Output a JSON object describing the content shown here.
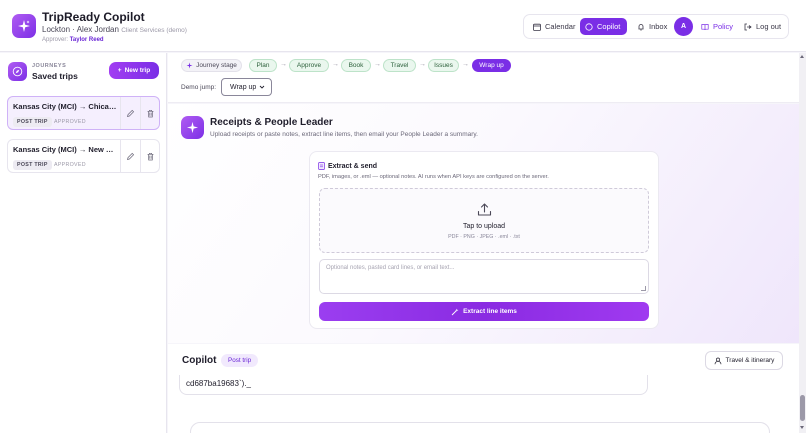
{
  "header": {
    "app_title": "TripReady Copilot",
    "org": "Lockton",
    "user": "Alex Jordan",
    "dept": "Client Services (demo)",
    "approver_label": "Approver:",
    "approver_name": "Taylor Reed",
    "nav": {
      "calendar": "Calendar",
      "copilot": "Copilot",
      "inbox": "Inbox",
      "avatar": "A",
      "policy": "Policy",
      "logout": "Log out"
    }
  },
  "sidebar": {
    "kicker": "JOURNEYS",
    "title": "Saved trips",
    "new_trip": "New trip",
    "trips": [
      {
        "name": "Kansas City (MCI) → Chicago",
        "tag": "POST TRIP",
        "status": "APPROVED"
      },
      {
        "name": "Kansas City (MCI) → New York",
        "tag": "POST TRIP",
        "status": "APPROVED"
      }
    ]
  },
  "stages": {
    "label": "Journey stage",
    "items": [
      "Plan",
      "Approve",
      "Book",
      "Travel",
      "Issues",
      "Wrap up"
    ],
    "active": "Wrap up",
    "jump_label": "Demo jump:",
    "jump_value": "Wrap up"
  },
  "receipts": {
    "title": "Receipts & People Leader",
    "subtitle": "Upload receipts or paste notes, extract line items, then email your People Leader a summary.",
    "card_title": "Extract & send",
    "card_sub": "PDF, images, or .eml — optional notes. AI runs when API keys are configured on the server.",
    "upload_title": "Tap to upload",
    "upload_formats": "PDF · PNG · JPEG · .eml · .txt",
    "notes_placeholder": "Optional notes, pasted card lines, or email text...",
    "extract_button": "Extract line items"
  },
  "copilot": {
    "title": "Copilot",
    "tag": "Post trip",
    "button": "Travel & itinerary",
    "message": "cd687ba19683`)._"
  },
  "colors": {
    "accent": "#7a2ee6",
    "accent_light": "#f1e9fd",
    "stage_done": "#eaf7ee"
  }
}
